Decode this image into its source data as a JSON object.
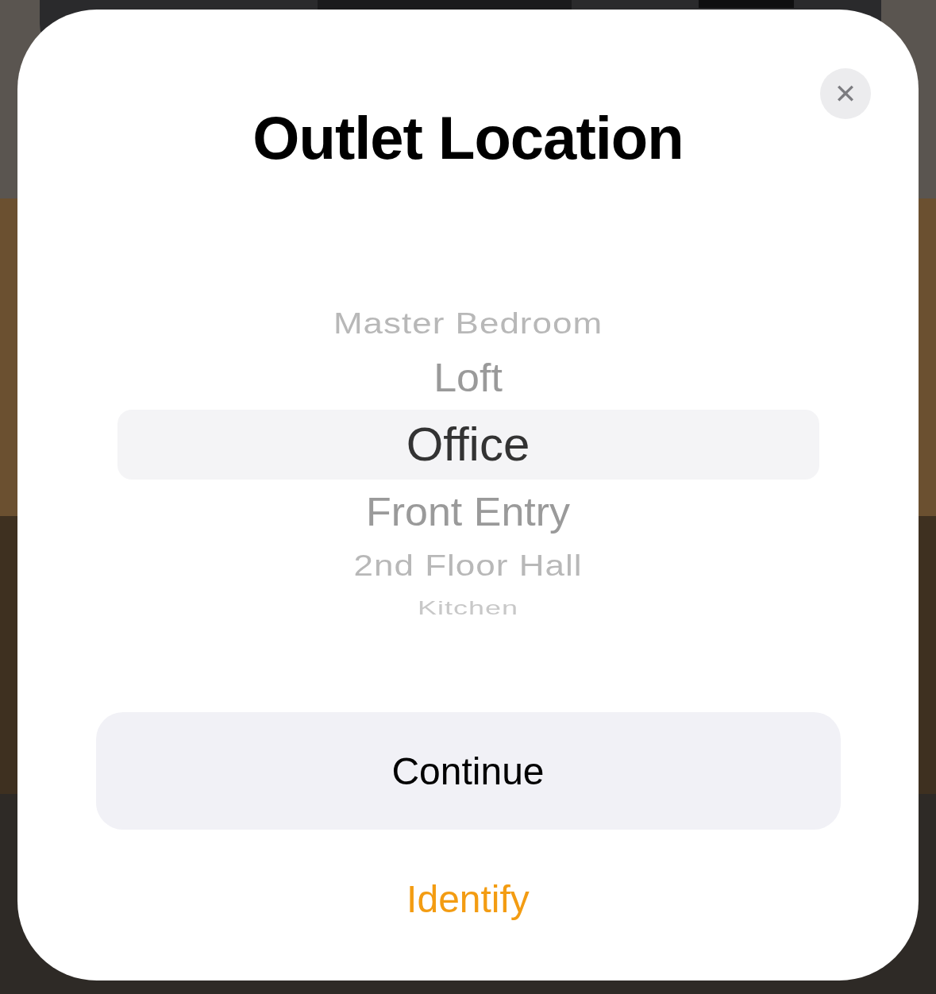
{
  "sheet": {
    "title": "Outlet Location",
    "close_label": "✕"
  },
  "picker": {
    "items": [
      {
        "label": "Master Bedroom",
        "selected": false
      },
      {
        "label": "Loft",
        "selected": false
      },
      {
        "label": "Office",
        "selected": true
      },
      {
        "label": "Front Entry",
        "selected": false
      },
      {
        "label": "2nd Floor Hall",
        "selected": false
      },
      {
        "label": "Kitchen",
        "selected": false
      }
    ]
  },
  "buttons": {
    "primary": "Continue",
    "secondary": "Identify"
  }
}
